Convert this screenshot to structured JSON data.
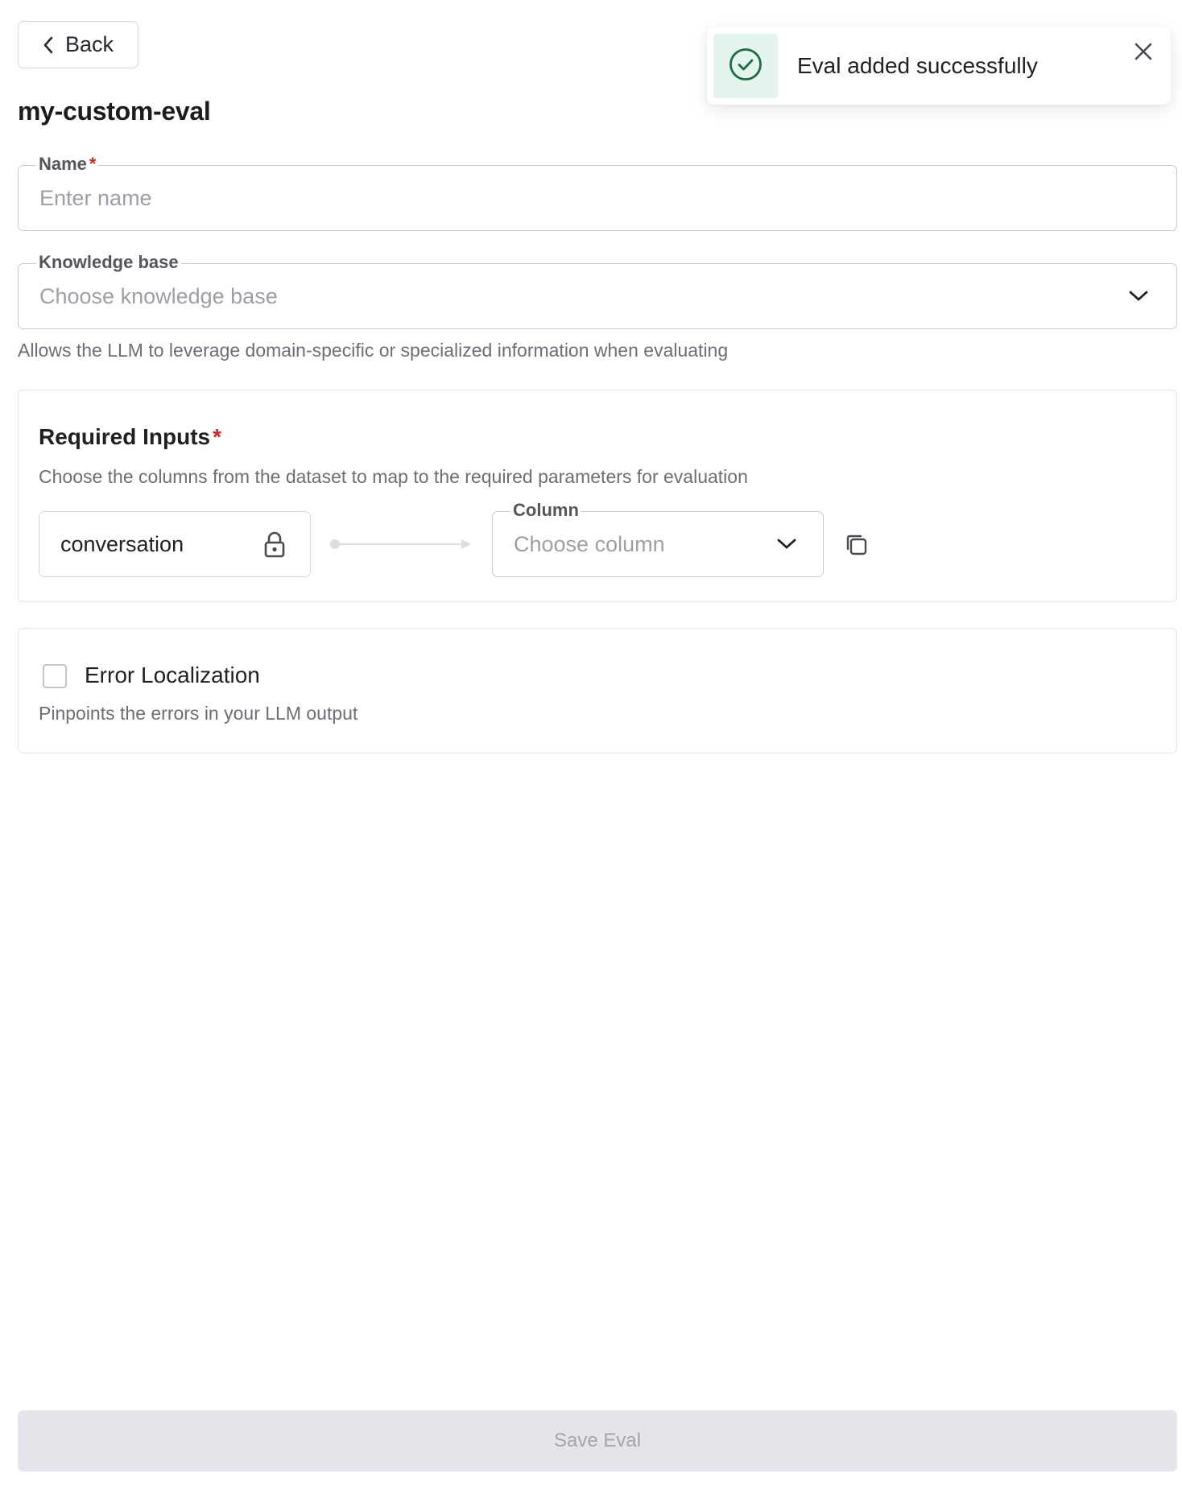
{
  "header": {
    "back_label": "Back",
    "title": "my-custom-eval"
  },
  "form": {
    "name": {
      "label": "Name",
      "required_marker": "*",
      "placeholder": "Enter name",
      "value": ""
    },
    "knowledge_base": {
      "label": "Knowledge base",
      "placeholder": "Choose knowledge base",
      "helper": "Allows the LLM to leverage domain-specific or specialized information when evaluating"
    }
  },
  "required_inputs": {
    "title": "Required Inputs",
    "required_marker": "*",
    "description": "Choose the columns from the dataset to map to the required parameters for evaluation",
    "mapping": {
      "parameter": "conversation",
      "column_label": "Column",
      "column_placeholder": "Choose column"
    }
  },
  "error_localization": {
    "label": "Error Localization",
    "checked": false,
    "description": "Pinpoints the errors in your LLM output"
  },
  "footer": {
    "save_label": "Save Eval"
  },
  "toast": {
    "message": "Eval added successfully",
    "icon": "check-circle-icon"
  },
  "colors": {
    "required": "#d0281f",
    "success_icon": "#1e6a4a",
    "success_bg": "#e3f5ec",
    "disabled_button_bg": "#e4e4ea"
  }
}
